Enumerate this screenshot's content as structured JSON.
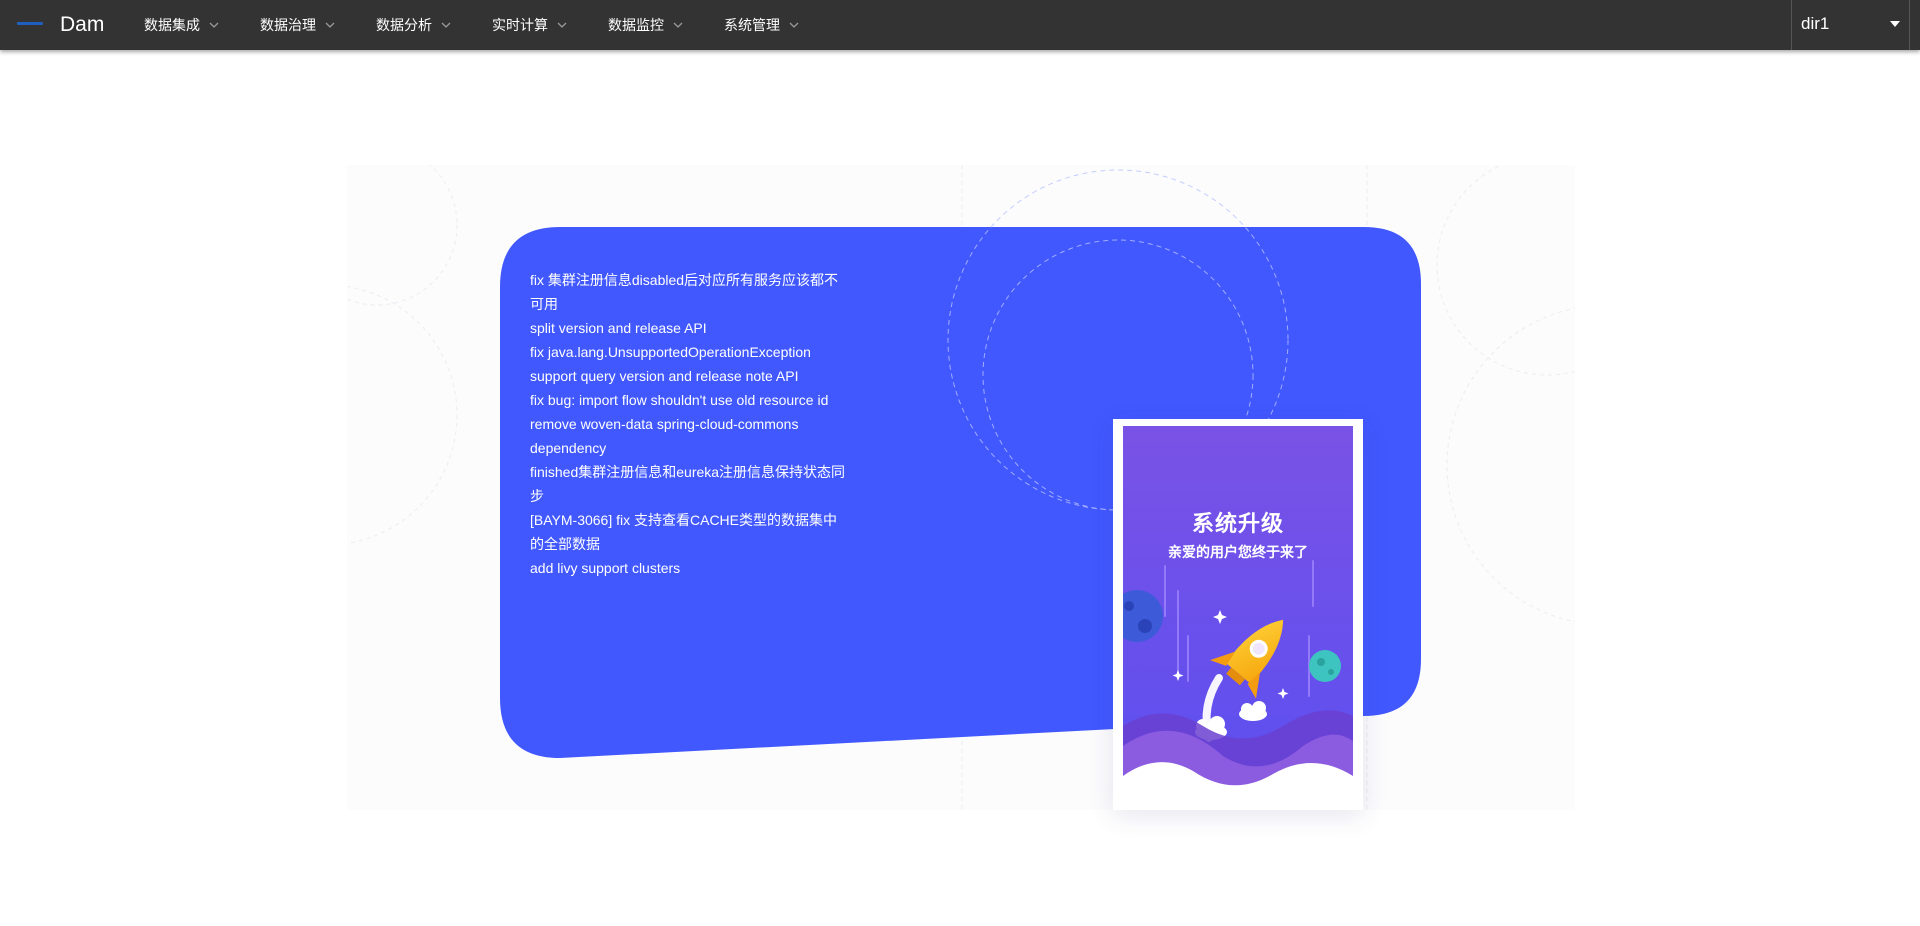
{
  "app": {
    "brand": "Dam"
  },
  "nav": {
    "items": [
      {
        "label": "数据集成"
      },
      {
        "label": "数据治理"
      },
      {
        "label": "数据分析"
      },
      {
        "label": "实时计算"
      },
      {
        "label": "数据监控"
      },
      {
        "label": "系统管理"
      }
    ]
  },
  "user": {
    "name": "dir1"
  },
  "release_notes": [
    "fix 集群注册信息disabled后对应所有服务应该都不可用",
    "split version and release API",
    "fix java.lang.UnsupportedOperationException",
    "support query version and release note API",
    "fix bug: import flow shouldn't use old resource id",
    "remove woven-data spring-cloud-commons dependency",
    "finished集群注册信息和eureka注册信息保持状态同步",
    "[BAYM-3066] fix 支持查看CACHE类型的数据集中的全部数据",
    "add livy support clusters"
  ],
  "poster": {
    "title": "系统升级",
    "subtitle": "亲爱的用户您终于来了"
  },
  "colors": {
    "topbar": "#333333",
    "card": "#4158ff",
    "poster_bg": "#6e56e8"
  },
  "icons": {
    "logo": "logo-icon",
    "nav_chevron": "chevron-down-icon",
    "user_caret": "caret-down-icon",
    "rocket": "rocket-icon"
  }
}
